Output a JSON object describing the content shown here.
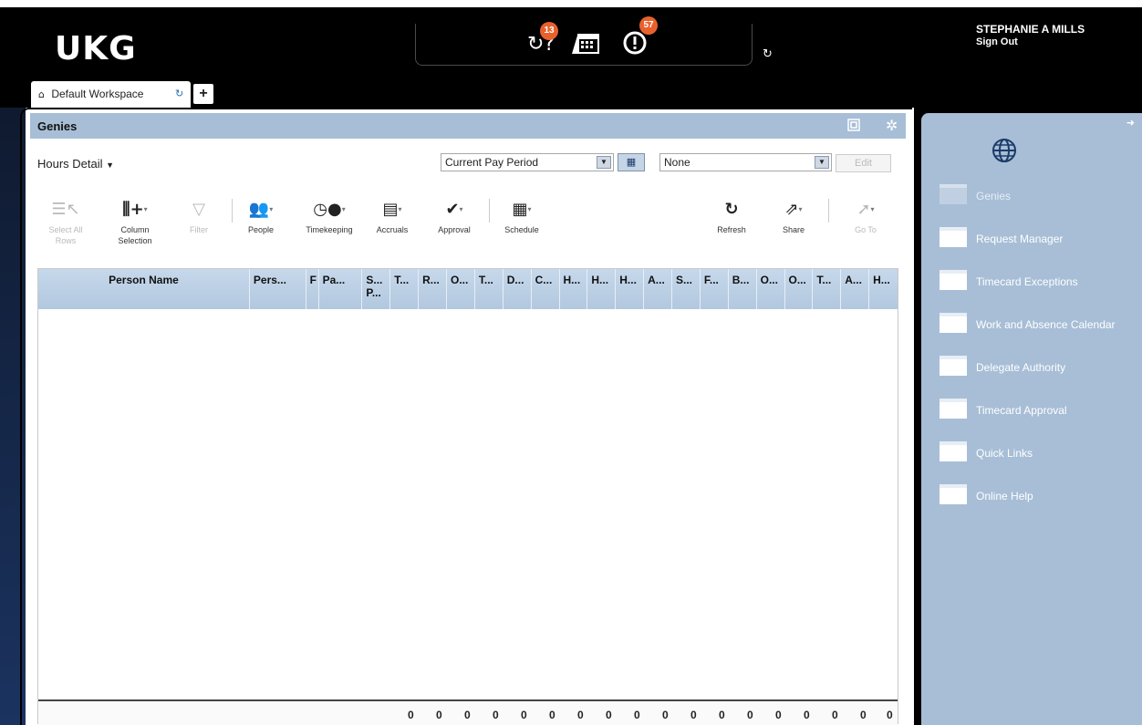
{
  "app": {
    "logo": "UKG",
    "user_name": "STEPHANIE A MILLS",
    "sign_out": "Sign Out",
    "badges": {
      "requests": "13",
      "alerts": "57"
    },
    "accent_color": "#e8612c",
    "icons": [
      "request-question-icon",
      "calendar-icon",
      "alert-icon",
      "refresh-icon"
    ]
  },
  "tabs": {
    "active_label": "Default Workspace",
    "add_label": "+"
  },
  "panel": {
    "title": "Genies",
    "genie_select": "Hours Detail",
    "timeframe": "Current Pay Period",
    "hyperfind": "None",
    "edit_label": "Edit"
  },
  "toolbar": {
    "select_all": [
      "Select All",
      "Rows"
    ],
    "column_selection": [
      "Column",
      "Selection"
    ],
    "filter": "Filter",
    "people": "People",
    "timekeeping": "Timekeeping",
    "accruals": "Accruals",
    "approval": "Approval",
    "schedule": "Schedule",
    "refresh": "Refresh",
    "share": "Share",
    "goto": "Go To"
  },
  "grid": {
    "columns": [
      "Person Name",
      "Pers...",
      "F",
      "Pa...",
      "S... P...",
      "T...",
      "R...",
      "O...",
      "T...",
      "D...",
      "C...",
      "H...",
      "H...",
      "H...",
      "A...",
      "S...",
      "F...",
      "B...",
      "O...",
      "O...",
      "T...",
      "A...",
      "H..."
    ],
    "totals": [
      "0",
      "0",
      "0",
      "0",
      "0",
      "0",
      "0",
      "0",
      "0",
      "0",
      "0",
      "0",
      "0",
      "0",
      "0",
      "0",
      "0",
      "0"
    ]
  },
  "sidebar": {
    "items": [
      {
        "label": "Genies",
        "active": true
      },
      {
        "label": "Request Manager"
      },
      {
        "label": "Timecard Exceptions"
      },
      {
        "label": "Work and Absence Calendar"
      },
      {
        "label": "Delegate Authority"
      },
      {
        "label": "Timecard Approval"
      },
      {
        "label": "Quick Links"
      },
      {
        "label": "Online Help"
      }
    ]
  }
}
